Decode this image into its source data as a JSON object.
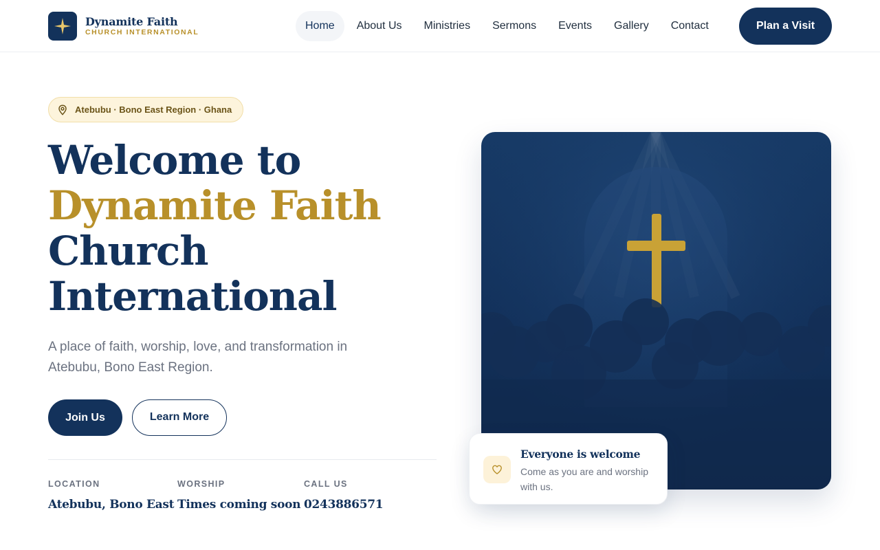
{
  "brand": {
    "name": "Dynamite Faith",
    "subtitle": "CHURCH INTERNATIONAL",
    "navy": "#13325b",
    "gold": "#b8902a"
  },
  "nav": {
    "items": [
      {
        "label": "Home",
        "active": true
      },
      {
        "label": "About Us"
      },
      {
        "label": "Ministries"
      },
      {
        "label": "Sermons"
      },
      {
        "label": "Events"
      },
      {
        "label": "Gallery"
      },
      {
        "label": "Contact"
      }
    ],
    "cta": "Plan a Visit"
  },
  "hero": {
    "badge": "Atebubu · Bono East Region · Ghana",
    "title_line1": "Welcome to",
    "title_line2": "Dynamite Faith",
    "title_line3": "Church",
    "title_line4": "International",
    "description": "A place of faith, worship, love, and transformation in Atebubu, Bono East Region.",
    "primary_button": "Join Us",
    "secondary_button": "Learn More"
  },
  "info": [
    {
      "label": "LOCATION",
      "value": "Atebubu, Bono East"
    },
    {
      "label": "WORSHIP",
      "value": "Times coming soon"
    },
    {
      "label": "CALL US",
      "value": "0243886571"
    }
  ],
  "welcome_card": {
    "icon": "heart-icon",
    "title": "Everyone is welcome",
    "text": "Come as you are and worship with us."
  },
  "icons": {
    "logo": "star-icon",
    "badge": "location-pin-icon",
    "hero": "cross-icon"
  }
}
